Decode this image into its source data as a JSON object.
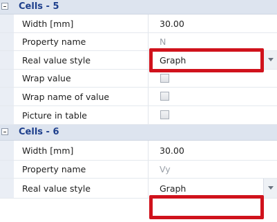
{
  "grid": {
    "section_5": {
      "title": "Cells - 5",
      "rows": [
        {
          "label": "Width [mm]",
          "value": "30.00"
        },
        {
          "label": "Property name",
          "value": "N"
        },
        {
          "label": "Real value style",
          "value": "Graph"
        },
        {
          "label": "Wrap value",
          "checked": false
        },
        {
          "label": "Wrap name of value",
          "checked": false
        },
        {
          "label": "Picture in table",
          "checked": false
        }
      ]
    },
    "section_6": {
      "title": "Cells - 6",
      "rows": [
        {
          "label": "Width [mm]",
          "value": "30.00"
        },
        {
          "label": "Property name",
          "value": "Vy"
        },
        {
          "label": "Real value style",
          "value": "Graph"
        }
      ]
    }
  },
  "icons": {
    "collapse": "collapse-minus-icon",
    "dropdown": "dropdown-arrow-icon"
  },
  "colors": {
    "highlight_border": "#d0121c",
    "section_header_text": "#1e3f8c",
    "section_header_bg": "#dde4ef"
  }
}
